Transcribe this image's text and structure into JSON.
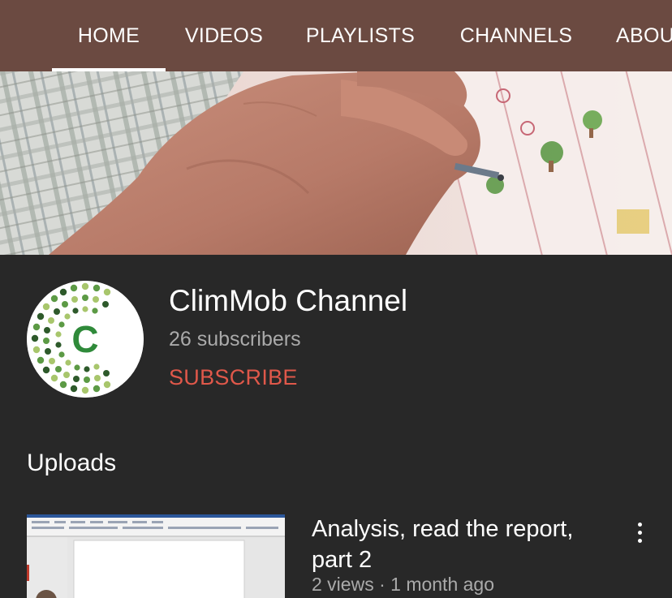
{
  "tabs": {
    "home": "HOME",
    "videos": "VIDEOS",
    "playlists": "PLAYLISTS",
    "channels": "CHANNELS",
    "about": "ABOUT"
  },
  "active_tab": "home",
  "banner": {
    "image": "hand-drawing-on-worksheet-photo"
  },
  "channel": {
    "avatar_letter": "C",
    "avatar_icon": "climmob-logo-icon",
    "name": "ClimMob Channel",
    "subscribers": "26 subscribers",
    "subscribe_label": "SUBSCRIBE"
  },
  "uploads": {
    "title": "Uploads",
    "videos": [
      {
        "title": "Analysis, read the report, part 2",
        "meta": "2 views · 1 month ago",
        "thumbnail": "word-document-screenshot-thumbnail"
      }
    ]
  },
  "colors": {
    "tabbar": "#6b4a41",
    "background": "#282828",
    "subscribe": "#e0584a",
    "secondary_text": "#aaaaaa",
    "logo_dark": "#2e5a2b",
    "logo_mid": "#5c9a45",
    "logo_light": "#a8c66c"
  }
}
